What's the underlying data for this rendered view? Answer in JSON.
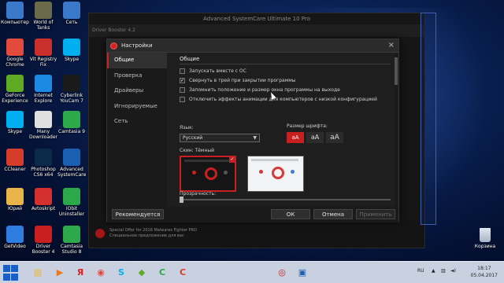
{
  "desktop": {
    "icons": [
      {
        "label": "Компьютер",
        "icon": "computer-icon",
        "color": "#3a78c9"
      },
      {
        "label": "World of Tanks",
        "icon": "tank-icon",
        "color": "#6b6b4a"
      },
      {
        "label": "Сеть",
        "icon": "network-icon",
        "color": "#3a78c9"
      },
      {
        "label": "Google Chrome",
        "icon": "chrome-icon",
        "color": "#e24a3b"
      },
      {
        "label": "Vit Registry Fix",
        "icon": "registry-icon",
        "color": "#c9302c"
      },
      {
        "label": "Skype",
        "icon": "skype-icon",
        "color": "#00aff0"
      },
      {
        "label": "GeForce Experience",
        "icon": "geforce-icon",
        "color": "#5faa23"
      },
      {
        "label": "Internet Explore",
        "icon": "ie-icon",
        "color": "#1e88e5"
      },
      {
        "label": "Cyberlink YouCam 7",
        "icon": "youcam-icon",
        "color": "#1a1a1a"
      },
      {
        "label": "Skype",
        "icon": "skype-icon",
        "color": "#00aff0"
      },
      {
        "label": "Many Downloader",
        "icon": "downloader-icon",
        "color": "#e0e0e0"
      },
      {
        "label": "Camtasia 9",
        "icon": "camtasia-icon",
        "color": "#2da84a"
      },
      {
        "label": "CCleaner",
        "icon": "ccleaner-icon",
        "color": "#d63c2b"
      },
      {
        "label": "Photoshop CS6 x64",
        "icon": "photoshop-icon",
        "color": "#0b2a4a"
      },
      {
        "label": "Advanced SystemCare",
        "icon": "asc-icon",
        "color": "#1a5fb0"
      },
      {
        "label": "Юрий",
        "icon": "user-folder-icon",
        "color": "#e8b44a"
      },
      {
        "label": "Avtoskript",
        "icon": "avtoskript-icon",
        "color": "#d43030"
      },
      {
        "label": "IObit Uninstaller",
        "icon": "uninstaller-icon",
        "color": "#2aa84a"
      },
      {
        "label": "GetVideo",
        "icon": "getvideo-icon",
        "color": "#2f7de1"
      },
      {
        "label": "Driver Booster 4",
        "icon": "driver-booster-icon",
        "color": "#c82020"
      },
      {
        "label": "Camtasia Studio 8",
        "icon": "camtasia-icon",
        "color": "#2da84a"
      }
    ],
    "recycle_bin": {
      "label": "Корзина",
      "icon": "recycle-bin-icon"
    }
  },
  "background_window": {
    "title": "Advanced SystemCare Ultimate 10 Pro",
    "tab": "Driver Booster 4.2",
    "bottom_line1": "Special Offer for 2016 Malwares Fighter PRO",
    "bottom_line2": "Специальное предложение для вас"
  },
  "dialog": {
    "title": "Настройки",
    "nav": [
      {
        "label": "Общие",
        "active": true
      },
      {
        "label": "Проверка",
        "active": false
      },
      {
        "label": "Драйверы",
        "active": false
      },
      {
        "label": "Игнорируемые",
        "active": false
      },
      {
        "label": "Сеть",
        "active": false
      }
    ],
    "section_title": "Общие",
    "options": [
      {
        "label": "Запускать вместе с ОС",
        "checked": false
      },
      {
        "label": "Свернуть в трей при закрытии программы",
        "checked": true
      },
      {
        "label": "Запомнить положение и размер окна программы на выходе",
        "checked": false
      },
      {
        "label": "Отключить эффекты анимации для компьютеров с низкой конфигурацией",
        "checked": false
      }
    ],
    "language_label": "Язык:",
    "language_value": "Русский",
    "font_size_label": "Размер шрифта:",
    "font_sizes": [
      {
        "label": "aA",
        "selected": true
      },
      {
        "label": "aA",
        "selected": false
      },
      {
        "label": "aA",
        "selected": false
      }
    ],
    "skin_label": "Скин: Тёмный",
    "skins": [
      {
        "name": "dark",
        "selected": true
      },
      {
        "name": "light",
        "selected": false
      }
    ],
    "transparency_label": "Прозрачность:",
    "transparency_value": 0,
    "buttons": {
      "recommended": "Рекомендуется",
      "ok": "ОК",
      "cancel": "Отмена",
      "apply": "Применить"
    },
    "accent_color": "#c82020"
  },
  "taskbar": {
    "language": "RU",
    "time": "18:17",
    "date": "05.04.2017",
    "apps": [
      {
        "icon": "explorer-icon",
        "color": "#f0b429",
        "glyph": "▤"
      },
      {
        "icon": "media-player-icon",
        "color": "#e87722",
        "glyph": "▶"
      },
      {
        "icon": "yandex-icon",
        "color": "#e02020",
        "glyph": "Я"
      },
      {
        "icon": "chrome-icon",
        "color": "#e24a3b",
        "glyph": "◉"
      },
      {
        "icon": "skype-icon",
        "color": "#00aff0",
        "glyph": "S"
      },
      {
        "icon": "geforce-icon",
        "color": "#5faa23",
        "glyph": "◆"
      },
      {
        "icon": "camtasia-icon",
        "color": "#2da84a",
        "glyph": "C"
      },
      {
        "icon": "ccleaner-icon",
        "color": "#d63c2b",
        "glyph": "C"
      },
      {
        "icon": "driver-booster-icon",
        "color": "#c82020",
        "glyph": "◎"
      },
      {
        "icon": "asc-icon",
        "color": "#1a5fb0",
        "glyph": "▣"
      }
    ]
  }
}
